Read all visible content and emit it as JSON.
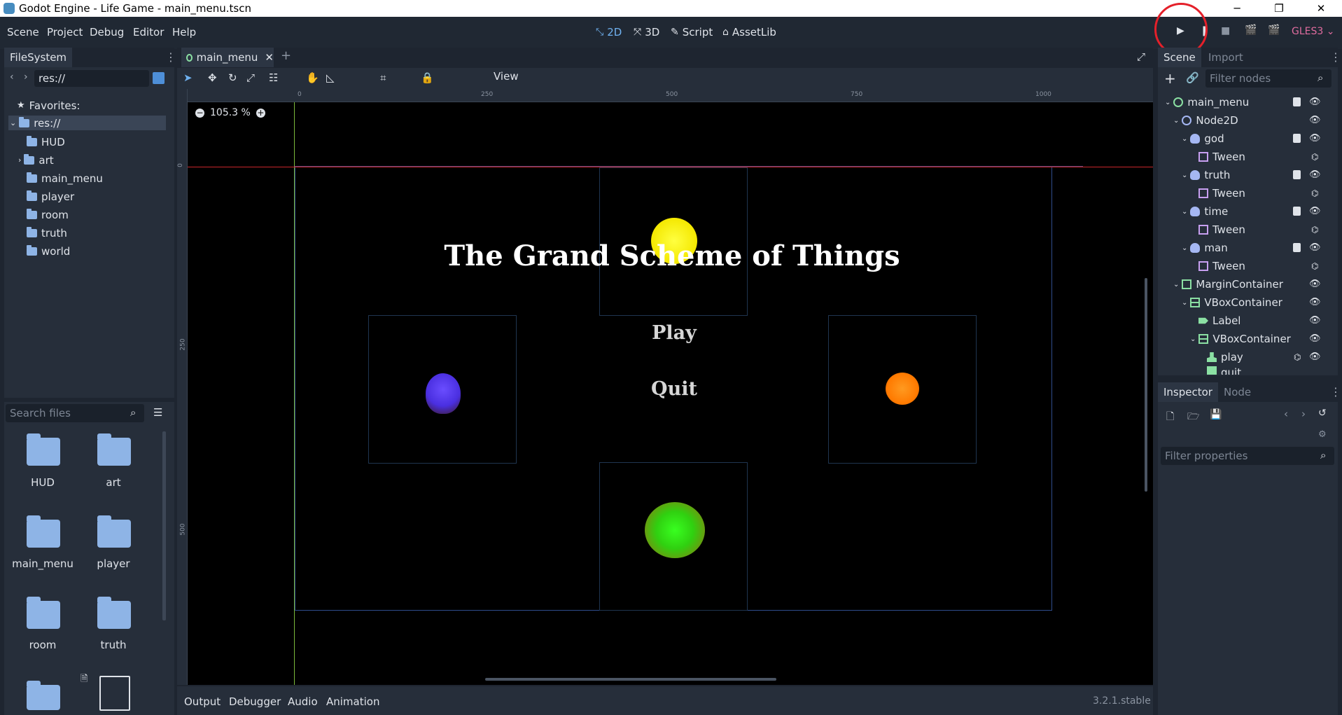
{
  "window": {
    "title": "Godot Engine - Life Game - main_menu.tscn",
    "controls": [
      "─",
      "❐",
      "✕"
    ]
  },
  "menubar": {
    "items": [
      "Scene",
      "Project",
      "Debug",
      "Editor",
      "Help"
    ],
    "workspaces": [
      {
        "label": "2D",
        "icon": "2d-icon",
        "active": true
      },
      {
        "label": "3D",
        "icon": "3d-icon",
        "active": false
      },
      {
        "label": "Script",
        "icon": "script-icon",
        "active": false
      },
      {
        "label": "AssetLib",
        "icon": "assetlib-icon",
        "active": false
      }
    ],
    "renderer": "GLES3"
  },
  "filesystem": {
    "tab": "FileSystem",
    "path": "res://",
    "favorites_label": "Favorites:",
    "root": "res://",
    "folders": [
      "HUD",
      "art",
      "main_menu",
      "player",
      "room",
      "truth",
      "world"
    ],
    "search_placeholder": "Search files",
    "grid": [
      "HUD",
      "art",
      "main_menu",
      "player",
      "room",
      "truth"
    ]
  },
  "editor": {
    "scene_tab": "main_menu",
    "view_menu": "View",
    "zoom": "105.3 %",
    "ruler_labels": {
      "h": [
        "0",
        "250",
        "500",
        "750",
        "1000"
      ],
      "v": [
        "0",
        "250",
        "500"
      ]
    },
    "game": {
      "title": "The Grand Scheme of Things",
      "play": "Play",
      "quit": "Quit"
    }
  },
  "scene_dock": {
    "tabs": [
      "Scene",
      "Import"
    ],
    "filter_placeholder": "Filter nodes",
    "nodes": [
      {
        "name": "main_menu",
        "type": "control-icon"
      },
      {
        "name": "Node2D",
        "type": "node2d-icon"
      },
      {
        "name": "god",
        "type": "particles-icon"
      },
      {
        "name": "Tween",
        "type": "tween-icon"
      },
      {
        "name": "truth",
        "type": "particles-icon"
      },
      {
        "name": "Tween",
        "type": "tween-icon"
      },
      {
        "name": "time",
        "type": "particles-icon"
      },
      {
        "name": "Tween",
        "type": "tween-icon"
      },
      {
        "name": "man",
        "type": "particles-icon"
      },
      {
        "name": "Tween",
        "type": "tween-icon"
      },
      {
        "name": "MarginContainer",
        "type": "margincontainer-icon"
      },
      {
        "name": "VBoxContainer",
        "type": "vbox-icon"
      },
      {
        "name": "Label",
        "type": "label-icon"
      },
      {
        "name": "VBoxContainer",
        "type": "vbox-icon"
      },
      {
        "name": "play",
        "type": "button-icon"
      },
      {
        "name": "quit",
        "type": "button-icon"
      }
    ]
  },
  "inspector": {
    "tabs": [
      "Inspector",
      "Node"
    ],
    "filter_placeholder": "Filter properties"
  },
  "bottom_panel": {
    "tabs": [
      "Output",
      "Debugger",
      "Audio",
      "Animation"
    ],
    "version": "3.2.1.stable"
  },
  "colors": {
    "accent": "#6fb1f0",
    "bg": "#1e2530",
    "panel": "#262e3a",
    "highlight": "#e4202a",
    "renderer": "#e06c9f"
  }
}
